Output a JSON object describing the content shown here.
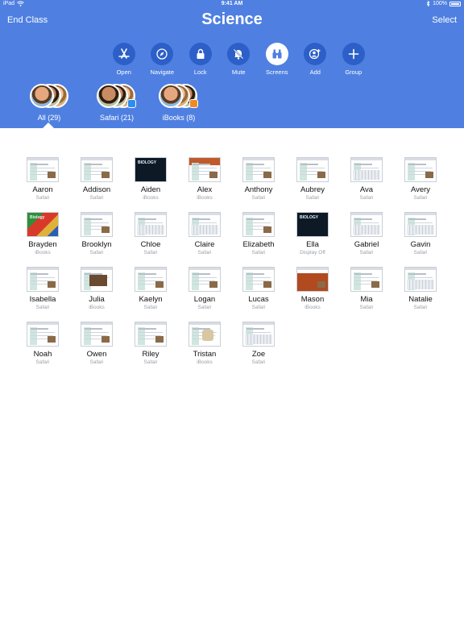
{
  "status_bar": {
    "device": "iPad",
    "time": "9:41 AM",
    "battery": "100%"
  },
  "nav": {
    "left_button": "End Class",
    "title": "Science",
    "right_button": "Select"
  },
  "toolbar": [
    {
      "label": "Open",
      "icon": "app-store-icon",
      "active": false
    },
    {
      "label": "Navigate",
      "icon": "compass-icon",
      "active": false
    },
    {
      "label": "Lock",
      "icon": "lock-icon",
      "active": false
    },
    {
      "label": "Mute",
      "icon": "bell-muted-icon",
      "active": false
    },
    {
      "label": "Screens",
      "icon": "binoculars-icon",
      "active": true
    },
    {
      "label": "Add",
      "icon": "add-person-icon",
      "active": false
    },
    {
      "label": "Group",
      "icon": "plus-icon",
      "active": false
    }
  ],
  "groups": [
    {
      "label": "All (29)",
      "selected": true
    },
    {
      "label": "Safari (21)",
      "selected": false
    },
    {
      "label": "iBooks (8)",
      "selected": false
    }
  ],
  "students": [
    {
      "name": "Aaron",
      "app": "Safari",
      "thumb": "doc"
    },
    {
      "name": "Addison",
      "app": "Safari",
      "thumb": "doc"
    },
    {
      "name": "Aiden",
      "app": "iBooks",
      "thumb": "biology",
      "cover": "BIOLOGY"
    },
    {
      "name": "Alex",
      "app": "iBooks",
      "thumb": "banner"
    },
    {
      "name": "Anthony",
      "app": "Safari",
      "thumb": "doc"
    },
    {
      "name": "Aubrey",
      "app": "Safari",
      "thumb": "doc"
    },
    {
      "name": "Ava",
      "app": "Safari",
      "thumb": "kb"
    },
    {
      "name": "Avery",
      "app": "Safari",
      "thumb": "doc"
    },
    {
      "name": "Brayden",
      "app": "iBooks",
      "thumb": "parrot",
      "cover": "Biology"
    },
    {
      "name": "Brooklyn",
      "app": "Safari",
      "thumb": "doc"
    },
    {
      "name": "Chloe",
      "app": "Safari",
      "thumb": "kb"
    },
    {
      "name": "Claire",
      "app": "Safari",
      "thumb": "kb"
    },
    {
      "name": "Elizabeth",
      "app": "Safari",
      "thumb": "doc"
    },
    {
      "name": "Ella",
      "app": "Display Off",
      "thumb": "biology",
      "cover": "BIOLOGY"
    },
    {
      "name": "Gabriel",
      "app": "Safari",
      "thumb": "kb"
    },
    {
      "name": "Gavin",
      "app": "Safari",
      "thumb": "kb"
    },
    {
      "name": "Isabella",
      "app": "Safari",
      "thumb": "doc"
    },
    {
      "name": "Julia",
      "app": "iBooks",
      "thumb": "photo"
    },
    {
      "name": "Kaelyn",
      "app": "Safari",
      "thumb": "doc"
    },
    {
      "name": "Logan",
      "app": "Safari",
      "thumb": "doc"
    },
    {
      "name": "Lucas",
      "app": "Safari",
      "thumb": "doc"
    },
    {
      "name": "Mason",
      "app": "iBooks",
      "thumb": "dark2"
    },
    {
      "name": "Mia",
      "app": "Safari",
      "thumb": "doc"
    },
    {
      "name": "Natalie",
      "app": "Safari",
      "thumb": "kb"
    },
    {
      "name": "Noah",
      "app": "Safari",
      "thumb": "doc"
    },
    {
      "name": "Owen",
      "app": "Safari",
      "thumb": "doc"
    },
    {
      "name": "Riley",
      "app": "Safari",
      "thumb": "doc"
    },
    {
      "name": "Tristan",
      "app": "iBooks",
      "thumb": "map"
    },
    {
      "name": "Zoe",
      "app": "Safari",
      "thumb": "kb"
    }
  ],
  "colors": {
    "header_bg": "#4f80e1",
    "button_bg": "#2c5fc7",
    "safari_badge": "#2b8ef0",
    "ibooks_badge": "#f08a24"
  }
}
